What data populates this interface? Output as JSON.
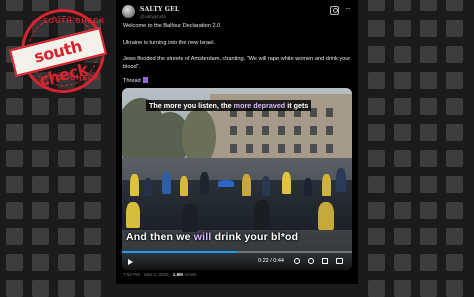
{
  "stamp": {
    "top_text": "SOUTH CHECK",
    "bottom_text": "FACT CHECK",
    "logo_text": "south check",
    "colors": {
      "stamp": "#d8242f",
      "badge_bg": "#f4f1eb"
    }
  },
  "post": {
    "author_name": "SALTY GEL",
    "author_handle": "@saltyginsta",
    "icons": {
      "grok": "grok-icon",
      "more": "more-options-icon"
    },
    "text": {
      "line1": "Welcome to the Balfour Declaration 2.0",
      "line2": "Ukraine is turning into the new Israel.",
      "line3": "Jews flooded the streets of Amsterdam, chanting, \"We will rape white women and drink your blood\".",
      "line4": "Thread"
    },
    "video": {
      "caption_top_pre": "The more you listen, the ",
      "caption_top_hl": "more depraved",
      "caption_top_post": " it gets",
      "caption_bottom_pre": "And then we ",
      "caption_bottom_hl": "will",
      "caption_bottom_post": " drink your bl*od",
      "time": "0:22 / 0:44",
      "progress": 0.5,
      "control_icons": [
        "play-icon",
        "volume-icon",
        "settings-icon",
        "fullscreen-icon"
      ]
    },
    "meta": {
      "time": "7:52 PM · Mar 3, 2025 · ",
      "views_count": "1.8M",
      "views_label": " Views"
    }
  },
  "colors": {
    "background": "#1b1b1b",
    "post_bg": "#000000",
    "caption_accent": "#d4b7ff",
    "link": "#1d9bf0"
  }
}
